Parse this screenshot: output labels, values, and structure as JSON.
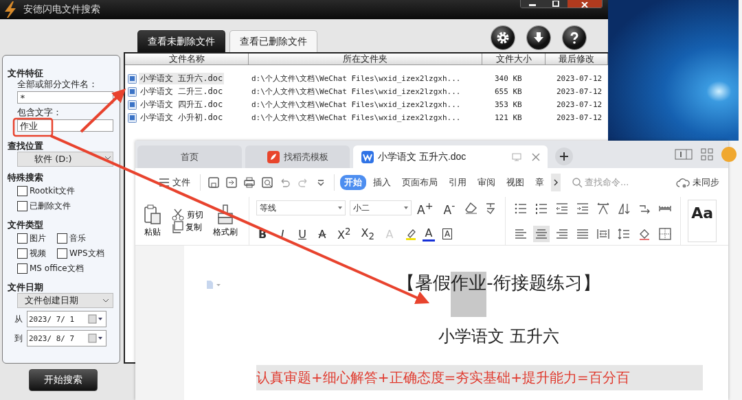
{
  "search_app": {
    "title": "安德闪电文件搜索",
    "tabs": [
      {
        "label": "查看未删除文件",
        "selected": true
      },
      {
        "label": "查看已删除文件",
        "selected": false
      }
    ],
    "toolbar": [
      {
        "kind": "settings"
      },
      {
        "kind": "download"
      },
      {
        "kind": "help"
      }
    ],
    "filters": {
      "features": {
        "heading": "文件特征",
        "name_label": "全部或部分文件名：",
        "name_value": "*",
        "text_label": "包含文字：",
        "text_value": "作业"
      },
      "location": {
        "heading": "查找位置",
        "value": "软件 (D:)"
      },
      "special": {
        "heading": "特殊搜索",
        "options": [
          {
            "label": "Rootkit文件",
            "checked": false
          },
          {
            "label": "已删除文件",
            "checked": false
          }
        ]
      },
      "types": {
        "heading": "文件类型",
        "options": [
          {
            "label": "图片",
            "checked": false
          },
          {
            "label": "音乐",
            "checked": false
          },
          {
            "label": "视频",
            "checked": false
          },
          {
            "label": "WPS文档",
            "checked": false
          },
          {
            "label": "MS office文档",
            "checked": false
          }
        ]
      },
      "date": {
        "heading": "文件日期",
        "mode": "文件创建日期",
        "from_label": "从",
        "from": "2023/ 7/ 1",
        "to_label": "到",
        "to": "2023/ 8/ 7"
      }
    },
    "search_button": "开始搜索",
    "table": {
      "columns": [
        "文件名称",
        "所在文件夹",
        "文件大小",
        "最后修改"
      ],
      "rows": [
        {
          "name": "小学语文 五升六.doc",
          "folder": "d:\\个人文件\\文档\\WeChat Files\\wxid_izex2lzgxh...",
          "size": "340 KB",
          "modified": "2023-07-12",
          "selected": true
        },
        {
          "name": "小学语文 二升三.doc",
          "folder": "d:\\个人文件\\文档\\WeChat Files\\wxid_izex2lzgxh...",
          "size": "655 KB",
          "modified": "2023-07-12",
          "selected": false
        },
        {
          "name": "小学语文 四升五.doc",
          "folder": "d:\\个人文件\\文档\\WeChat Files\\wxid_izex2lzgxh...",
          "size": "353 KB",
          "modified": "2023-07-12",
          "selected": false
        },
        {
          "name": "小学语文 小升初.doc",
          "folder": "d:\\个人文件\\文档\\WeChat Files\\wxid_izex2lzgxh...",
          "size": "121 KB",
          "modified": "2023-07-12",
          "selected": false
        }
      ]
    }
  },
  "wps": {
    "tabs": [
      {
        "label": "首页",
        "kind": "home",
        "selected": false
      },
      {
        "label": "找稻壳模板",
        "kind": "template",
        "selected": false
      },
      {
        "label": "小学语文 五升六.doc",
        "kind": "document",
        "selected": true
      }
    ],
    "file_menu": "文件",
    "ribbon_tabs": [
      {
        "label": "开始",
        "selected": true
      },
      {
        "label": "插入",
        "selected": false
      },
      {
        "label": "页面布局",
        "selected": false
      },
      {
        "label": "引用",
        "selected": false
      },
      {
        "label": "审阅",
        "selected": false
      },
      {
        "label": "视图",
        "selected": false
      },
      {
        "label": "章",
        "selected": false
      }
    ],
    "search_placeholder": "查找命令...",
    "sync": "未同步",
    "clipboard": {
      "paste": "粘贴",
      "cut": "剪切",
      "copy": "复制",
      "format_painter": "格式刷"
    },
    "font": {
      "name": "等线",
      "size": "小二"
    },
    "font_tools": [
      {
        "kind": "grow",
        "label": "A$^{+}$"
      },
      {
        "kind": "shrink",
        "label": "A$^{-}$"
      },
      {
        "kind": "clear"
      },
      {
        "kind": "pinyin"
      }
    ],
    "format_tools": [
      {
        "kind": "bold",
        "label": "B"
      },
      {
        "kind": "italic",
        "label": "I"
      },
      {
        "kind": "underline",
        "label": "U"
      },
      {
        "kind": "strike",
        "label": "A"
      },
      {
        "kind": "superscript",
        "label": "X$^{2}$"
      },
      {
        "kind": "subscript",
        "label": "X$_{2}$"
      },
      {
        "kind": "effect",
        "label": "A"
      },
      {
        "kind": "highlight"
      },
      {
        "kind": "color",
        "label": "A"
      },
      {
        "kind": "border",
        "label": "A"
      }
    ],
    "paragraph_tools": [
      [
        {
          "kind": "bullets",
          "selected": false
        },
        {
          "kind": "numbering",
          "selected": false
        },
        {
          "kind": "outdent",
          "selected": false
        },
        {
          "kind": "indent",
          "selected": false
        },
        {
          "kind": "direction",
          "selected": false
        },
        {
          "kind": "sort",
          "selected": false
        },
        {
          "kind": "line-break",
          "selected": false
        },
        {
          "kind": "ruler",
          "selected": false
        }
      ],
      [
        {
          "kind": "align-left",
          "selected": false
        },
        {
          "kind": "align-center",
          "selected": true
        },
        {
          "kind": "align-right",
          "selected": false
        },
        {
          "kind": "justify",
          "selected": false
        },
        {
          "kind": "distribute",
          "selected": false
        },
        {
          "kind": "line-spacing",
          "selected": false
        },
        {
          "kind": "shading",
          "selected": false
        },
        {
          "kind": "borders",
          "selected": false
        }
      ]
    ],
    "style_preview": "Aa",
    "document": {
      "title": [
        {
          "text": "【暑假",
          "highlighted": false
        },
        {
          "text": "作业",
          "highlighted": true
        },
        {
          "text": "-衔接题练习】",
          "highlighted": false
        }
      ],
      "subtitle": "小学语文  五升六",
      "motto": "认真审题+细心解答+正确态度=夯实基础+提升能力=百分百"
    }
  }
}
